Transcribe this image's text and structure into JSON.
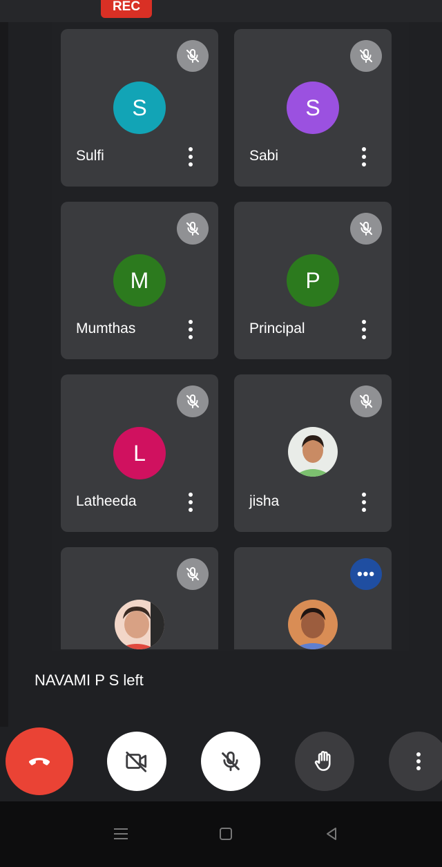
{
  "recording": {
    "label": "REC"
  },
  "participants": [
    {
      "name": "Sulfi",
      "initial": "S",
      "avatar_color": "#12a4b6"
    },
    {
      "name": "Sabi",
      "initial": "S",
      "avatar_color": "#9b51e0"
    },
    {
      "name": "Mumthas",
      "initial": "M",
      "avatar_color": "#2c7a1e"
    },
    {
      "name": "Principal",
      "initial": "P",
      "avatar_color": "#2c7a1e"
    },
    {
      "name": "Latheeda",
      "initial": "L",
      "avatar_color": "#d0115f"
    },
    {
      "name": "jisha",
      "initial": "",
      "avatar_color": ""
    }
  ],
  "toast": {
    "message": "NAVAMI P S left"
  },
  "controls": {
    "end_call": {
      "icon": "hang-up-icon",
      "color": "#ea4335"
    },
    "camera": {
      "icon": "camera-off-icon",
      "color": "#ffffff"
    },
    "microphone": {
      "icon": "mic-off-icon",
      "color": "#ffffff"
    },
    "raise_hand": {
      "icon": "raise-hand-icon",
      "color": "#3c3c3f"
    },
    "more_options": {
      "icon": "more-vertical-icon",
      "color": "#3c3c3f"
    }
  },
  "system_nav": {
    "recents": {
      "icon": "recents-icon"
    },
    "home": {
      "icon": "home-icon"
    },
    "back": {
      "icon": "back-icon"
    }
  }
}
